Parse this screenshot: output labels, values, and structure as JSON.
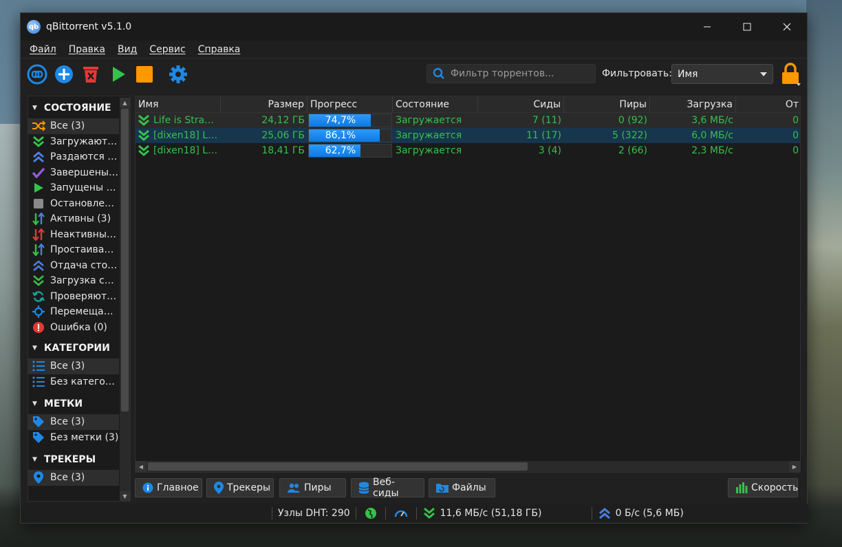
{
  "window": {
    "title": "qBittorrent v5.1.0",
    "logo_text": "qb"
  },
  "menu": [
    "Файл",
    "Правка",
    "Вид",
    "Сервис",
    "Справка"
  ],
  "toolbar": {
    "search_placeholder": "Фильтр торрентов...",
    "filter_label": "Фильтровать:",
    "filter_value": "Имя"
  },
  "sidebar": {
    "status_title": "СОСТОЯНИЕ",
    "status_items": [
      {
        "label": "Все (3)",
        "icon": "shuffle-icon"
      },
      {
        "label": "Загружаютс...",
        "icon": "download-chevrons-icon"
      },
      {
        "label": "Раздаются (0)",
        "icon": "upload-chevrons-icon"
      },
      {
        "label": "Завершены ...",
        "icon": "checkmark-icon"
      },
      {
        "label": "Запущены (3)",
        "icon": "play-icon"
      },
      {
        "label": "Остановлен...",
        "icon": "stop-icon"
      },
      {
        "label": "Активны (3)",
        "icon": "active-arrows-icon"
      },
      {
        "label": "Неактивны (0)",
        "icon": "inactive-arrows-icon"
      },
      {
        "label": "Простаиваю...",
        "icon": "stalled-arrows-icon"
      },
      {
        "label": "Отдача стои...",
        "icon": "stalled-upload-icon"
      },
      {
        "label": "Загрузка сто...",
        "icon": "stalled-download-icon"
      },
      {
        "label": "Проверяютс...",
        "icon": "refresh-icon"
      },
      {
        "label": "Перемещаю...",
        "icon": "move-icon"
      },
      {
        "label": "Ошибка (0)",
        "icon": "error-icon"
      }
    ],
    "categories_title": "КАТЕГОРИИ",
    "category_items": [
      {
        "label": "Все (3)",
        "icon": "list-icon"
      },
      {
        "label": "Без категор...",
        "icon": "list-icon"
      }
    ],
    "tags_title": "МЕТКИ",
    "tag_items": [
      {
        "label": "Все (3)",
        "icon": "tag-icon"
      },
      {
        "label": "Без метки (3)",
        "icon": "tag-icon"
      }
    ],
    "trackers_title": "ТРЕКЕРЫ",
    "tracker_items": [
      {
        "label": "Все (3)",
        "icon": "location-pin-icon"
      }
    ]
  },
  "table": {
    "headers": [
      "Имя",
      "Размер",
      "Прогресс",
      "Состояние",
      "Сиды",
      "Пиры",
      "Загрузка",
      "От"
    ],
    "rows": [
      {
        "name": "Life is Stran...",
        "size": "24,12 ГБ",
        "progress": 74.7,
        "progress_text": "74,7%",
        "state": "Загружается",
        "seeds": "7 (11)",
        "peers": "0 (92)",
        "down": "3,6 МБ/с",
        "up": "0"
      },
      {
        "name": "[dixen18] Li...",
        "size": "25,06 ГБ",
        "progress": 86.1,
        "progress_text": "86,1%",
        "state": "Загружается",
        "seeds": "11 (17)",
        "peers": "5 (322)",
        "down": "6,0 МБ/с",
        "up": "0"
      },
      {
        "name": "[dixen18] Li...",
        "size": "18,41 ГБ",
        "progress": 62.7,
        "progress_text": "62,7%",
        "state": "Загружается",
        "seeds": "3 (4)",
        "peers": "2 (66)",
        "down": "2,3 МБ/с",
        "up": "0"
      }
    ]
  },
  "tabs": [
    {
      "label": "Главное",
      "icon": "info-icon"
    },
    {
      "label": "Трекеры",
      "icon": "location-pin-icon"
    },
    {
      "label": "Пиры",
      "icon": "people-icon"
    },
    {
      "label": "Веб-сиды",
      "icon": "database-icon"
    },
    {
      "label": "Файлы",
      "icon": "folder-icon"
    }
  ],
  "speed_tab": {
    "label": "Скорость",
    "icon": "bar-chart-icon"
  },
  "statusbar": {
    "dht": "Узлы DHT: 290",
    "download": "11,6 МБ/с (51,18 ГБ)",
    "upload": "0 Б/с (5,6 МБ)"
  },
  "colors": {
    "accent": "#1e88e5",
    "green": "#35c24b",
    "orange": "#ff9800",
    "selected_row": "#17354d"
  }
}
